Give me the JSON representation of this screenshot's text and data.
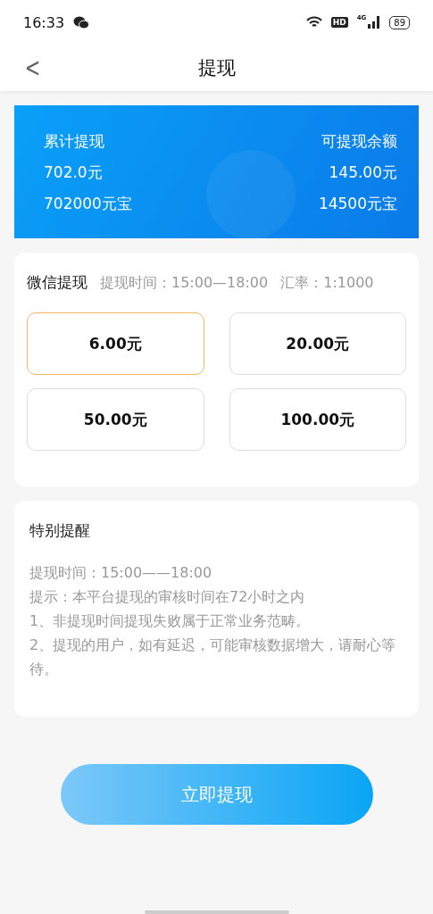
{
  "status_bar": {
    "time": "16:33",
    "hd": "HD",
    "network": "4G",
    "battery": "89"
  },
  "header": {
    "back": "<",
    "title": "提现"
  },
  "summary": {
    "left": [
      "累计提现",
      "702.0元",
      "702000元宝"
    ],
    "right": [
      "可提现余额",
      "145.00元",
      "14500元宝"
    ]
  },
  "withdraw": {
    "title": "微信提现",
    "time": "提现时间：15:00—18:00",
    "rate": "汇率：1:1000",
    "options": [
      {
        "label": "6.00元",
        "selected": true
      },
      {
        "label": "20.00元",
        "selected": false
      },
      {
        "label": "50.00元",
        "selected": false
      },
      {
        "label": "100.00元",
        "selected": false
      }
    ]
  },
  "notice": {
    "title": "特别提醒",
    "lines": [
      "提现时间：15:00——18:00",
      "提示：本平台提现的审核时间在72小时之内",
      "1、非提现时间提现失败属于正常业务范畴。",
      "2、提现的用户，如有延迟，可能审核数据增大，请耐心等待。"
    ]
  },
  "submit": "立即提现"
}
